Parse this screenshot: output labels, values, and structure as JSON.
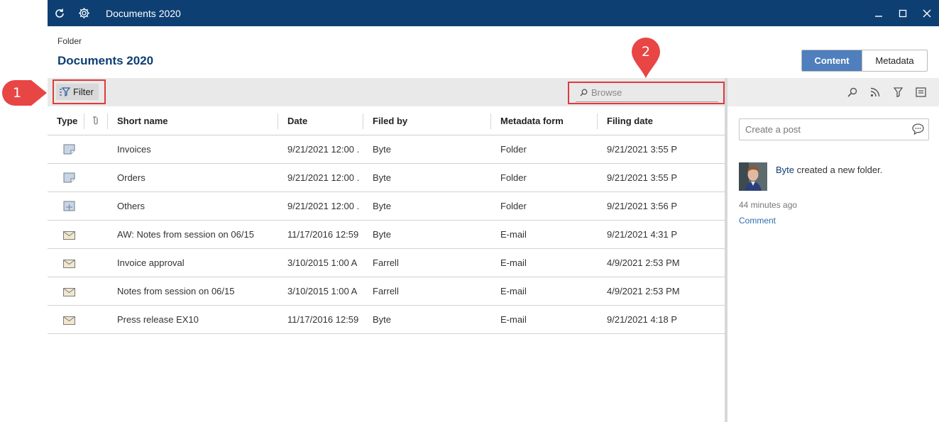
{
  "window": {
    "title": "Documents 2020",
    "title_color": "#0d3f73"
  },
  "header": {
    "breadcrumb": "Folder",
    "title": "Documents 2020"
  },
  "view_tabs": {
    "content_label": "Content",
    "metadata_label": "Metadata",
    "active": "Content"
  },
  "toolbar": {
    "filter_label": "Filter",
    "browse_placeholder": "Browse"
  },
  "callouts": {
    "one": "1",
    "two": "2",
    "color": "#e03a3a"
  },
  "table": {
    "columns": [
      "Type",
      "Short name",
      "Date",
      "Filed by",
      "Metadata form",
      "Filing date"
    ],
    "rows": [
      {
        "type_icon": "folder-icon",
        "name": "Invoices",
        "date": "9/21/2021 12:00 .",
        "filed_by": "Byte",
        "form": "Folder",
        "filing_date": "9/21/2021 3:55 P"
      },
      {
        "type_icon": "folder-icon",
        "name": "Orders",
        "date": "9/21/2021 12:00 .",
        "filed_by": "Byte",
        "form": "Folder",
        "filing_date": "9/21/2021 3:55 P"
      },
      {
        "type_icon": "folder-grid-icon",
        "name": "Others",
        "date": "9/21/2021 12:00 .",
        "filed_by": "Byte",
        "form": "Folder",
        "filing_date": "9/21/2021 3:56 P"
      },
      {
        "type_icon": "email-icon",
        "name": "AW: Notes from session on 06/15",
        "date": "11/17/2016 12:59",
        "filed_by": "Byte",
        "form": "E-mail",
        "filing_date": "9/21/2021 4:31 P"
      },
      {
        "type_icon": "email-icon",
        "name": "Invoice approval",
        "date": "3/10/2015 1:00 A",
        "filed_by": "Farrell",
        "form": "E-mail",
        "filing_date": "4/9/2021 2:53 PM"
      },
      {
        "type_icon": "email-icon",
        "name": "Notes from session on 06/15",
        "date": "3/10/2015 1:00 A",
        "filed_by": "Farrell",
        "form": "E-mail",
        "filing_date": "4/9/2021 2:53 PM"
      },
      {
        "type_icon": "email-icon",
        "name": "Press release EX10",
        "date": "11/17/2016 12:59",
        "filed_by": "Byte",
        "form": "E-mail",
        "filing_date": "9/21/2021 4:18 P"
      }
    ]
  },
  "feed": {
    "post_placeholder": "Create a post",
    "entry": {
      "user": "Byte",
      "action": " created a new folder.",
      "ago": "44 minutes ago",
      "comment_label": "Comment"
    }
  }
}
